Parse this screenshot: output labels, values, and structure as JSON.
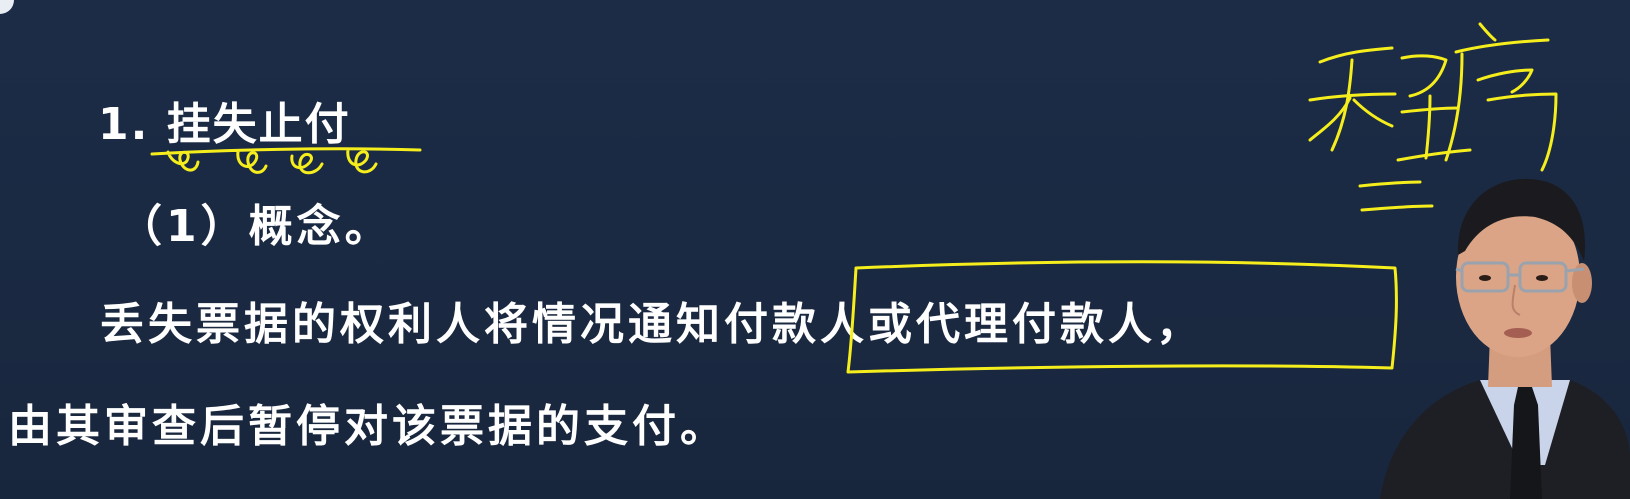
{
  "slide": {
    "heading": "1. 挂失止付",
    "concept": "（1）概念。",
    "line1": "丢失票据的权利人将情况通知付款人或代理付款人，",
    "line2": "由其审查后暂停对该票据的支付。"
  },
  "annotations": {
    "handwriting_note": "程序",
    "ink_color": "#f5ee1c"
  }
}
